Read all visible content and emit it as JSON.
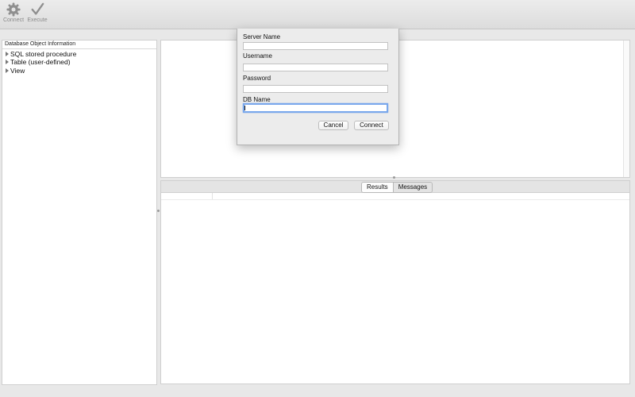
{
  "toolbar": {
    "connect_label": "Connect",
    "execute_label": "Execute",
    "connect_icon": "gear-icon",
    "execute_icon": "checkmark-icon"
  },
  "left_panel": {
    "header": "Database Object Information",
    "items": [
      {
        "label": "SQL stored procedure"
      },
      {
        "label": "Table (user-defined)"
      },
      {
        "label": "View"
      }
    ]
  },
  "results": {
    "tabs": [
      {
        "label": "Results",
        "selected": false
      },
      {
        "label": "Messages",
        "selected": true
      }
    ]
  },
  "dialog": {
    "fields": {
      "server_name": {
        "label": "Server Name",
        "value": ""
      },
      "username": {
        "label": "Username",
        "value": ""
      },
      "password": {
        "label": "Password",
        "value": ""
      },
      "db_name": {
        "label": "DB Name",
        "value": ""
      }
    },
    "cancel_label": "Cancel",
    "connect_label": "Connect"
  }
}
